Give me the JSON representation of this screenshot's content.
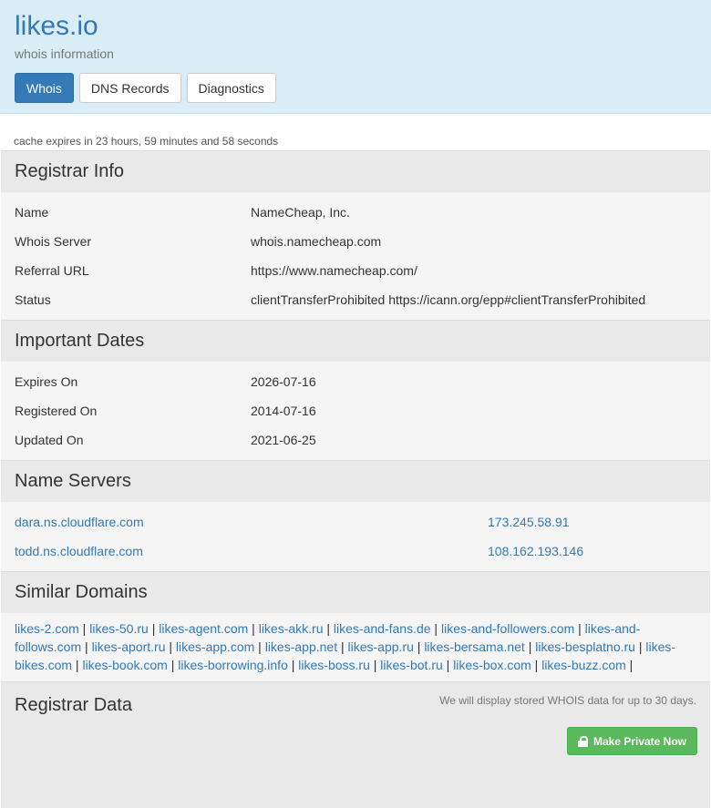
{
  "header": {
    "title": "likes.io",
    "subtitle": "whois information",
    "tabs": [
      {
        "label": "Whois",
        "active": true
      },
      {
        "label": "DNS Records",
        "active": false
      },
      {
        "label": "Diagnostics",
        "active": false
      }
    ]
  },
  "cache_notice": "cache expires in 23 hours, 59 minutes and 58 seconds",
  "registrar_info": {
    "heading": "Registrar Info",
    "rows": [
      {
        "key": "Name",
        "value": "NameCheap, Inc."
      },
      {
        "key": "Whois Server",
        "value": "whois.namecheap.com"
      },
      {
        "key": "Referral URL",
        "value": "https://www.namecheap.com/"
      },
      {
        "key": "Status",
        "value": "clientTransferProhibited https://icann.org/epp#clientTransferProhibited"
      }
    ]
  },
  "important_dates": {
    "heading": "Important Dates",
    "rows": [
      {
        "key": "Expires On",
        "value": "2026-07-16"
      },
      {
        "key": "Registered On",
        "value": "2014-07-16"
      },
      {
        "key": "Updated On",
        "value": "2021-06-25"
      }
    ]
  },
  "name_servers": {
    "heading": "Name Servers",
    "rows": [
      {
        "host": "dara.ns.cloudflare.com",
        "ip": "173.245.58.91"
      },
      {
        "host": "todd.ns.cloudflare.com",
        "ip": "108.162.193.146"
      }
    ]
  },
  "similar_domains": {
    "heading": "Similar Domains",
    "items": [
      "likes-2.com",
      "likes-50.ru",
      "likes-agent.com",
      "likes-akk.ru",
      "likes-and-fans.de",
      "likes-and-followers.com",
      "likes-and-follows.com",
      "likes-aport.ru",
      "likes-app.com",
      "likes-app.net",
      "likes-app.ru",
      "likes-bersama.net",
      "likes-besplatno.ru",
      "likes-bikes.com",
      "likes-book.com",
      "likes-borrowing.info",
      "likes-boss.ru",
      "likes-bot.ru",
      "likes-box.com",
      "likes-buzz.com"
    ],
    "separator": " | "
  },
  "registrar_data": {
    "heading": "Registrar Data",
    "note": "We will display stored WHOIS data for up to 30 days.",
    "button_label": "Make Private Now"
  },
  "colors": {
    "header_bg": "#d9edf7",
    "link": "#337ab7",
    "active_tab": "#337ab7",
    "private_button": "#5cb85c",
    "section_head_bg": "#e9e9e9",
    "row_bg": "#f5f5f5"
  }
}
